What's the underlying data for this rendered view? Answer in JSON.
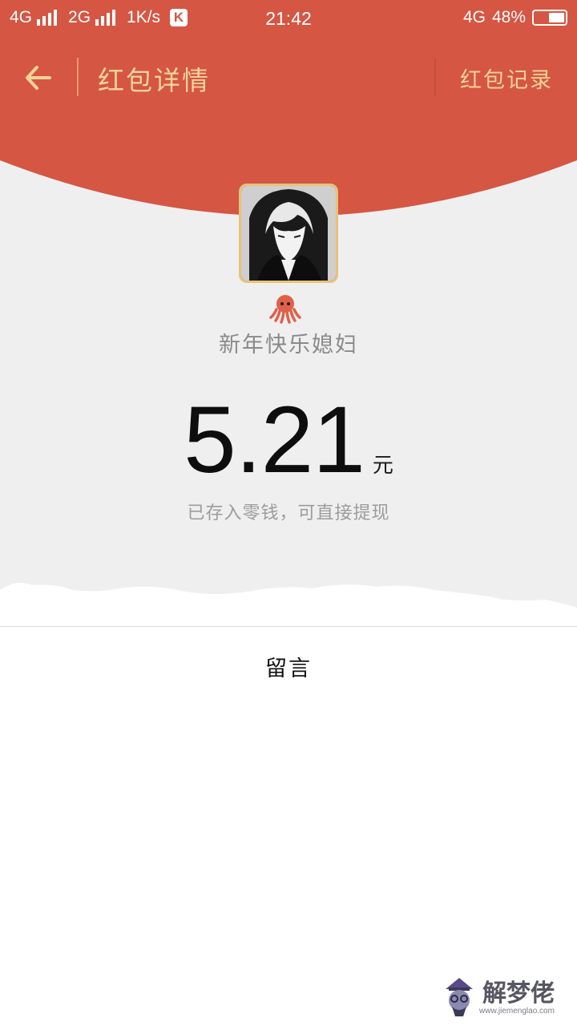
{
  "status_bar": {
    "network_1": "4G",
    "network_2": "2G",
    "speed": "1K/s",
    "k_badge": "K",
    "time": "21:42",
    "network_right": "4G",
    "battery": "48%",
    "battery_level": 0.48
  },
  "nav": {
    "back_icon": "arrow-left-icon",
    "title": "红包详情",
    "record_label": "红包记录"
  },
  "sender": {
    "avatar_icon": "anime-avatar",
    "emoji_icon": "octopus-icon",
    "name": "新年快乐媳妇"
  },
  "amount": {
    "value": "5.21",
    "unit": "元",
    "note": "已存入零钱，可直接提现"
  },
  "message_section": {
    "label": "留言"
  },
  "watermark": {
    "text": "解梦佬",
    "url": "www.jiemenglao.com"
  },
  "colors": {
    "header_red": "#d55643",
    "gold_text": "#f4d399",
    "background_gray": "#efeff0"
  }
}
